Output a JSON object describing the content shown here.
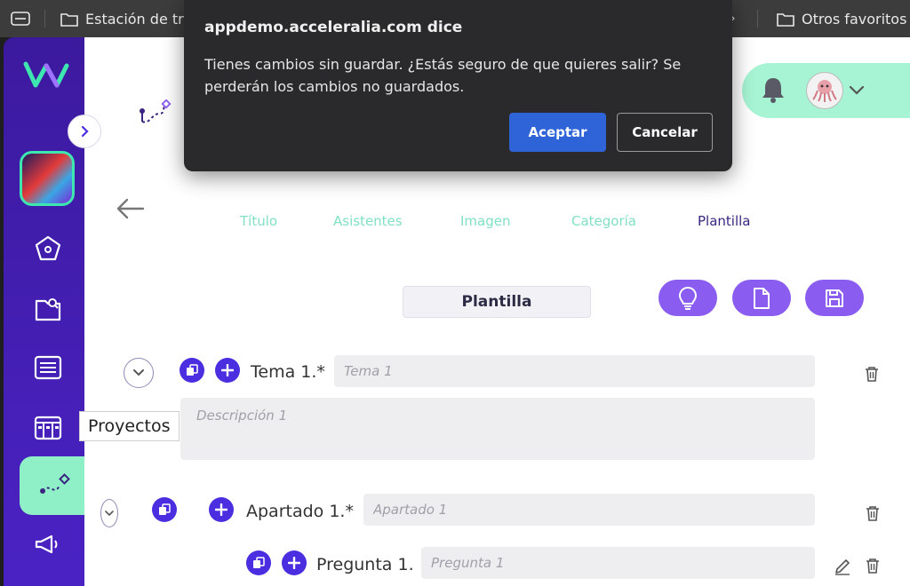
{
  "browser": {
    "bookmarks": [
      {
        "label": "Estación de tral",
        "icon": "folder-icon"
      },
      {
        "label": "Otros favoritos",
        "icon": "folder-icon"
      }
    ]
  },
  "sidebar": {
    "tooltip": "Proyectos",
    "items": [
      {
        "icon": "pentagon-icon"
      },
      {
        "icon": "folder-search-icon"
      },
      {
        "icon": "list-icon"
      },
      {
        "icon": "board-icon"
      },
      {
        "icon": "route-icon"
      },
      {
        "icon": "megaphone-icon"
      }
    ]
  },
  "steps": [
    {
      "label": "Título",
      "active": false
    },
    {
      "label": "Asistentes",
      "active": false
    },
    {
      "label": "Imagen",
      "active": false
    },
    {
      "label": "Categoría",
      "active": false
    },
    {
      "label": "Plantilla",
      "active": true
    }
  ],
  "section": {
    "title": "Plantilla"
  },
  "form": {
    "tema": {
      "label": "Tema 1.*",
      "placeholder": "Tema 1"
    },
    "descripcion": {
      "placeholder": "Descripción 1"
    },
    "apartado": {
      "label": "Apartado 1.*",
      "placeholder": "Apartado 1"
    },
    "pregunta": {
      "label": "Pregunta 1.",
      "placeholder": "Pregunta 1"
    }
  },
  "dialog": {
    "title": "appdemo.acceleralia.com dice",
    "message": "Tienes cambios sin guardar. ¿Estás seguro de que quieres salir? Se perderán los cambios no guardados.",
    "ok": "Aceptar",
    "cancel": "Cancelar"
  },
  "colors": {
    "sidebar": "#3c1a9e",
    "accent": "#8b5cf0",
    "mint": "#a6f4d3",
    "primary": "#4b2ee0",
    "dialog_ok": "#2f64d8"
  }
}
